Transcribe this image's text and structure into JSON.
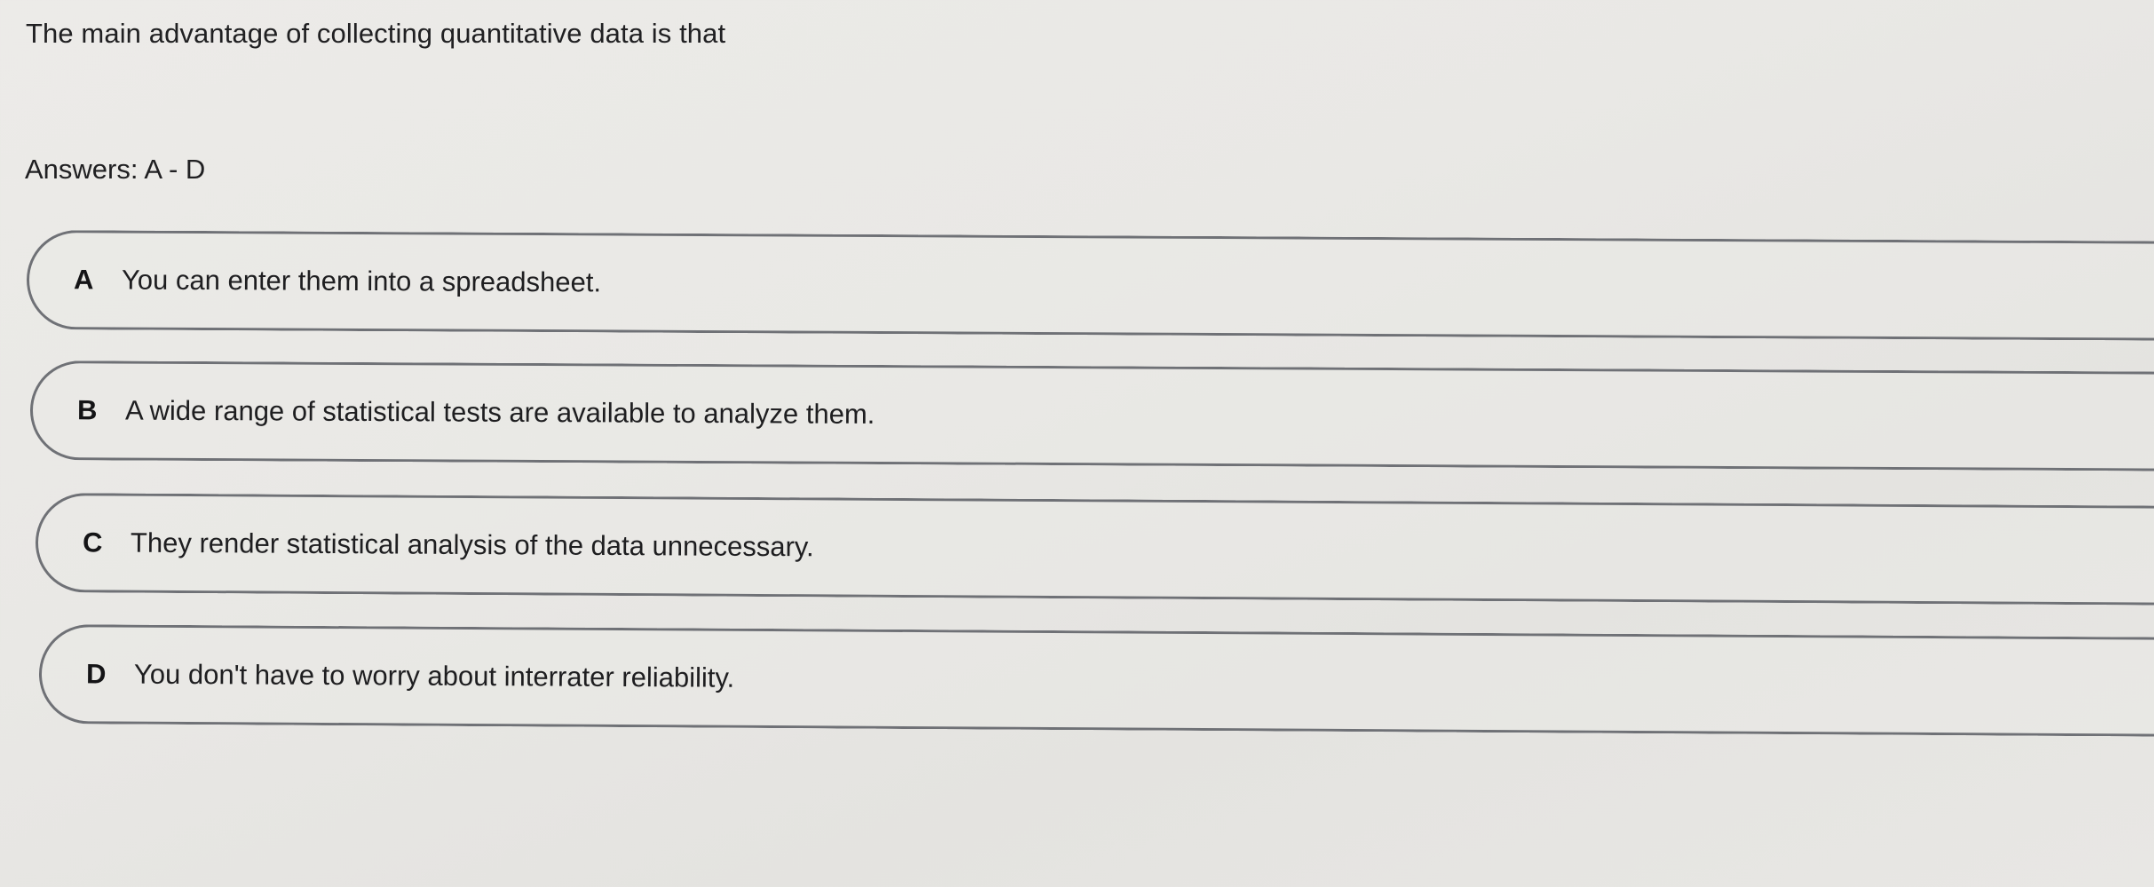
{
  "question": {
    "text": "The main advantage of collecting quantitative data is that"
  },
  "answers_label": "Answers: A - D",
  "options": [
    {
      "letter": "A",
      "text": "You can enter them into a spreadsheet."
    },
    {
      "letter": "B",
      "text": "A wide range of statistical tests are available to analyze them."
    },
    {
      "letter": "C",
      "text": "They render statistical analysis of the data unnecessary."
    },
    {
      "letter": "D",
      "text": "You don't have to worry about interrater reliability."
    }
  ]
}
